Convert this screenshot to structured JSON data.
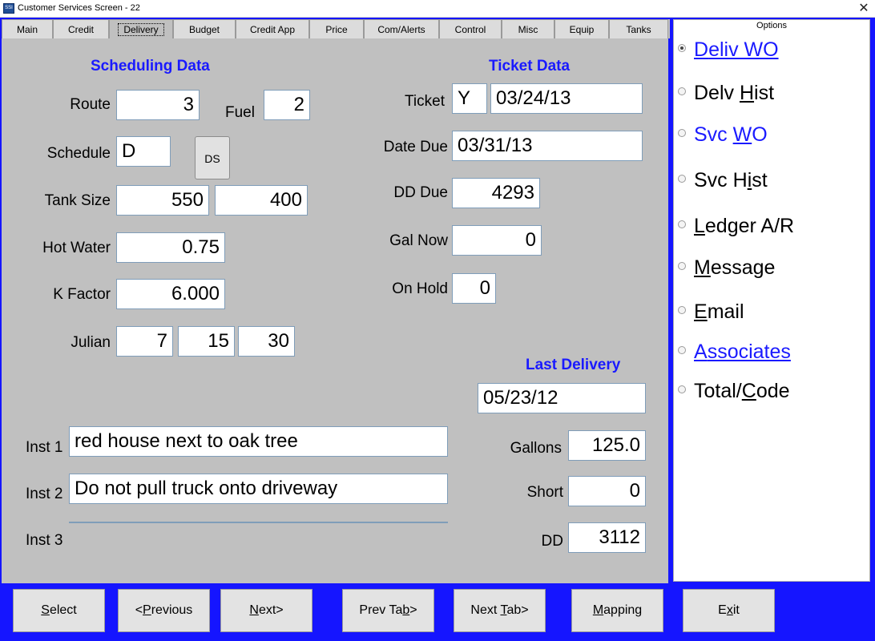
{
  "window": {
    "title": "Customer Services Screen - 22",
    "app_icon_text": "SSI",
    "close_glyph": "✕"
  },
  "tabs": [
    {
      "label": "Main"
    },
    {
      "label": "Credit"
    },
    {
      "label": "Delivery"
    },
    {
      "label": "Budget"
    },
    {
      "label": "Credit App"
    },
    {
      "label": "Price"
    },
    {
      "label": "Com/Alerts"
    },
    {
      "label": "Control"
    },
    {
      "label": "Misc"
    },
    {
      "label": "Equip"
    },
    {
      "label": "Tanks"
    }
  ],
  "active_tab": "Delivery",
  "scheduling": {
    "heading": "Scheduling Data",
    "route_label": "Route",
    "route_value": "3",
    "fuel_label": "Fuel",
    "fuel_value": "2",
    "schedule_label": "Schedule",
    "schedule_value": "D",
    "ds_button": "DS",
    "tank_size_label": "Tank Size",
    "tank_size_value": "550",
    "tank_size_value2": "400",
    "hot_water_label": "Hot Water",
    "hot_water_value": "0.75",
    "k_factor_label": "K Factor",
    "k_factor_value": "6.000",
    "julian_label": "Julian",
    "julian_values": [
      "7",
      "15",
      "30"
    ]
  },
  "ticket": {
    "heading": "Ticket Data",
    "ticket_label": "Ticket",
    "ticket_flag": "Y",
    "ticket_date": "03/24/13",
    "date_due_label": "Date Due",
    "date_due_value": "03/31/13",
    "dd_due_label": "DD Due",
    "dd_due_value": "4293",
    "gal_now_label": "Gal Now",
    "gal_now_value": "0",
    "on_hold_label": "On Hold",
    "on_hold_value": "0"
  },
  "last_delivery": {
    "heading": "Last Delivery",
    "date_value": "05/23/12",
    "gallons_label": "Gallons",
    "gallons_value": "125.0",
    "short_label": "Short",
    "short_value": "0",
    "dd_label": "DD",
    "dd_value": "3112"
  },
  "instructions": {
    "inst1_label": "Inst 1",
    "inst1_value": "red house next to oak tree",
    "inst2_label": "Inst 2",
    "inst2_value": "Do not pull truck onto driveway",
    "inst3_label": "Inst 3",
    "inst3_value": ""
  },
  "options": {
    "title": "Options",
    "items": [
      {
        "pre": "",
        "key": "D",
        "post": "eliv WO",
        "checked": true,
        "color": "#1a1aff"
      },
      {
        "pre": "Delv ",
        "key": "H",
        "post": "ist",
        "checked": false,
        "color": "#000000"
      },
      {
        "pre": "Svc ",
        "key": "W",
        "post": "O",
        "checked": false,
        "color": "#1a1aff"
      },
      {
        "pre": "Svc H",
        "key": "i",
        "post": "st",
        "checked": false,
        "color": "#000000"
      },
      {
        "pre": "",
        "key": "L",
        "post": "edger A/R",
        "checked": false,
        "color": "#000000"
      },
      {
        "pre": "",
        "key": "M",
        "post": "essage",
        "checked": false,
        "color": "#000000"
      },
      {
        "pre": "",
        "key": "E",
        "post": "mail",
        "checked": false,
        "color": "#000000"
      },
      {
        "pre": "",
        "key": "A",
        "post": "ssociates",
        "checked": false,
        "color": "#1a1aff"
      },
      {
        "pre": "Total/",
        "key": "C",
        "post": "ode",
        "checked": false,
        "color": "#000000"
      }
    ]
  },
  "buttons": [
    {
      "pre": "",
      "key": "S",
      "post": "elect"
    },
    {
      "pre": "<",
      "key": "P",
      "post": "revious"
    },
    {
      "pre": "",
      "key": "N",
      "post": "ext>"
    },
    {
      "pre": "Prev Ta",
      "key": "b",
      "post": ">"
    },
    {
      "pre": "Next ",
      "key": "T",
      "post": "ab>"
    },
    {
      "pre": "",
      "key": "M",
      "post": "apping"
    },
    {
      "pre": "E",
      "key": "x",
      "post": "it"
    }
  ],
  "colors": {
    "frame_blue": "#1515ff",
    "heading_blue": "#1a1aff",
    "panel_gray": "#c0c0c0"
  }
}
